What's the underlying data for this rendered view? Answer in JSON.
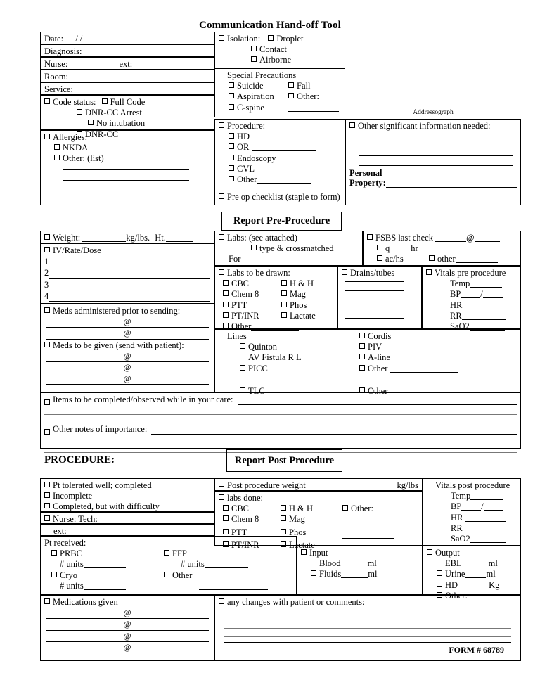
{
  "document": {
    "title": "Communication Hand-off Tool",
    "form_number": "FORM  # 68789",
    "addressograph": "Addressograph",
    "procedure_label": "PROCEDURE:",
    "section_pre": "Report Pre-Procedure",
    "section_post": "Report Post Procedure"
  },
  "patient": {
    "date_label": "Date:",
    "date_value": "/    /",
    "diagnosis_label": "Diagnosis:",
    "nurse_label": "Nurse:",
    "ext_label": "ext:",
    "room_label": "Room:",
    "service_label": "Service:"
  },
  "code_status": {
    "label": "Code status:",
    "options": [
      "Full Code",
      "DNR-CC Arrest",
      "No intubation",
      "DNR-CC"
    ]
  },
  "allergies": {
    "label": "Allergies:",
    "nkda": "NKDA",
    "other": "Other: (list)"
  },
  "isolation": {
    "label": "Isolation:",
    "options": [
      "Droplet",
      "Contact",
      "Airborne"
    ]
  },
  "special_precautions": {
    "label": "Special Precautions",
    "col1": [
      "Suicide",
      "Aspiration",
      "C-spine"
    ],
    "col2": [
      "Fall",
      "Other:"
    ]
  },
  "procedure_box": {
    "label": "Procedure:",
    "options": [
      "HD",
      "OR",
      "Endoscopy",
      "CVL",
      "Other"
    ],
    "preop": "Pre op checklist (staple to form)"
  },
  "other_info": {
    "label": "Other significant information needed:",
    "personal_property_line1": "Personal",
    "personal_property_line2": "Property:"
  },
  "weight": {
    "label": "Weight:",
    "units": "kg/lbs.",
    "height_label": "Ht."
  },
  "iv": {
    "label": "IV/Rate/Dose",
    "numbers": [
      "1",
      "2",
      "3",
      "4"
    ]
  },
  "meds_prior": {
    "label": "Meds administered prior to sending:",
    "at": "@",
    "rows": 2
  },
  "meds_given_with": {
    "label": "Meds to be given (send with patient):",
    "at": "@",
    "rows": 3
  },
  "labs_attached": {
    "label": "Labs: (see attached)",
    "type_cross": "type & crossmatched",
    "for": "For"
  },
  "fsbs": {
    "label": "FSBS last check",
    "at": "@",
    "q": "q",
    "hr": "hr",
    "achs": "ac/hs",
    "other": "other"
  },
  "labs_drawn": {
    "label": "Labs to be drawn:",
    "col1": [
      "CBC",
      "Chem 8",
      "PTT",
      "PT/INR",
      "Other"
    ],
    "col2": [
      "H & H",
      "Mag",
      "Phos",
      "Lactate"
    ]
  },
  "drains": {
    "label": "Drains/tubes",
    "line_count": 5
  },
  "vitals_pre": {
    "label": "Vitals pre procedure",
    "items": [
      "Temp",
      "BP",
      "HR",
      "RR",
      "SaO2"
    ],
    "bp_separator": "/"
  },
  "lines": {
    "label": "Lines",
    "col1": [
      "Quinton",
      "AV Fistula    R    L",
      "PICC",
      "TLC"
    ],
    "col2": [
      "Cordis",
      "PIV",
      "A-line",
      "Other",
      "Other"
    ]
  },
  "items_care": {
    "label": "Items to be completed/observed while in your care:"
  },
  "other_notes": {
    "label": "Other notes of importance:"
  },
  "post_tolerance": {
    "options": [
      "Pt tolerated well; completed",
      "Incomplete",
      "Completed, but with difficulty"
    ]
  },
  "post_nurse": {
    "label": "Nurse: Tech:",
    "ext_label": "ext:"
  },
  "pt_received": {
    "label": "Pt received:",
    "col1": [
      "PRBC",
      "Cryo"
    ],
    "col2": [
      "FFP",
      "Other"
    ],
    "units_label": "# units"
  },
  "post_weight": {
    "label": "Post procedure weight",
    "units": "kg/lbs"
  },
  "labs_done": {
    "label": "labs done:",
    "col1": [
      "CBC",
      "Chem 8",
      "PTT",
      "PT/INR"
    ],
    "col2": [
      "H & H",
      "Mag",
      "Phos",
      "Lactate"
    ],
    "col3": "Other:"
  },
  "vitals_post": {
    "label": "Vitals post procedure",
    "items": [
      "Temp",
      "BP",
      "HR",
      "RR",
      "SaO2"
    ],
    "bp_separator": "/"
  },
  "input": {
    "label": "Input",
    "items": [
      {
        "name": "Blood",
        "unit": "ml"
      },
      {
        "name": "Fluids",
        "unit": "ml"
      }
    ]
  },
  "output": {
    "label": "Output",
    "items": [
      {
        "name": "EBL",
        "unit": "ml"
      },
      {
        "name": "Urine",
        "unit": "ml"
      },
      {
        "name": "HD",
        "unit": "Kg"
      },
      {
        "name": "Other:",
        "unit": ""
      }
    ]
  },
  "medications_given": {
    "label": "Medications given",
    "at": "@",
    "rows": 4
  },
  "changes": {
    "label": "any changes with patient or comments:"
  }
}
